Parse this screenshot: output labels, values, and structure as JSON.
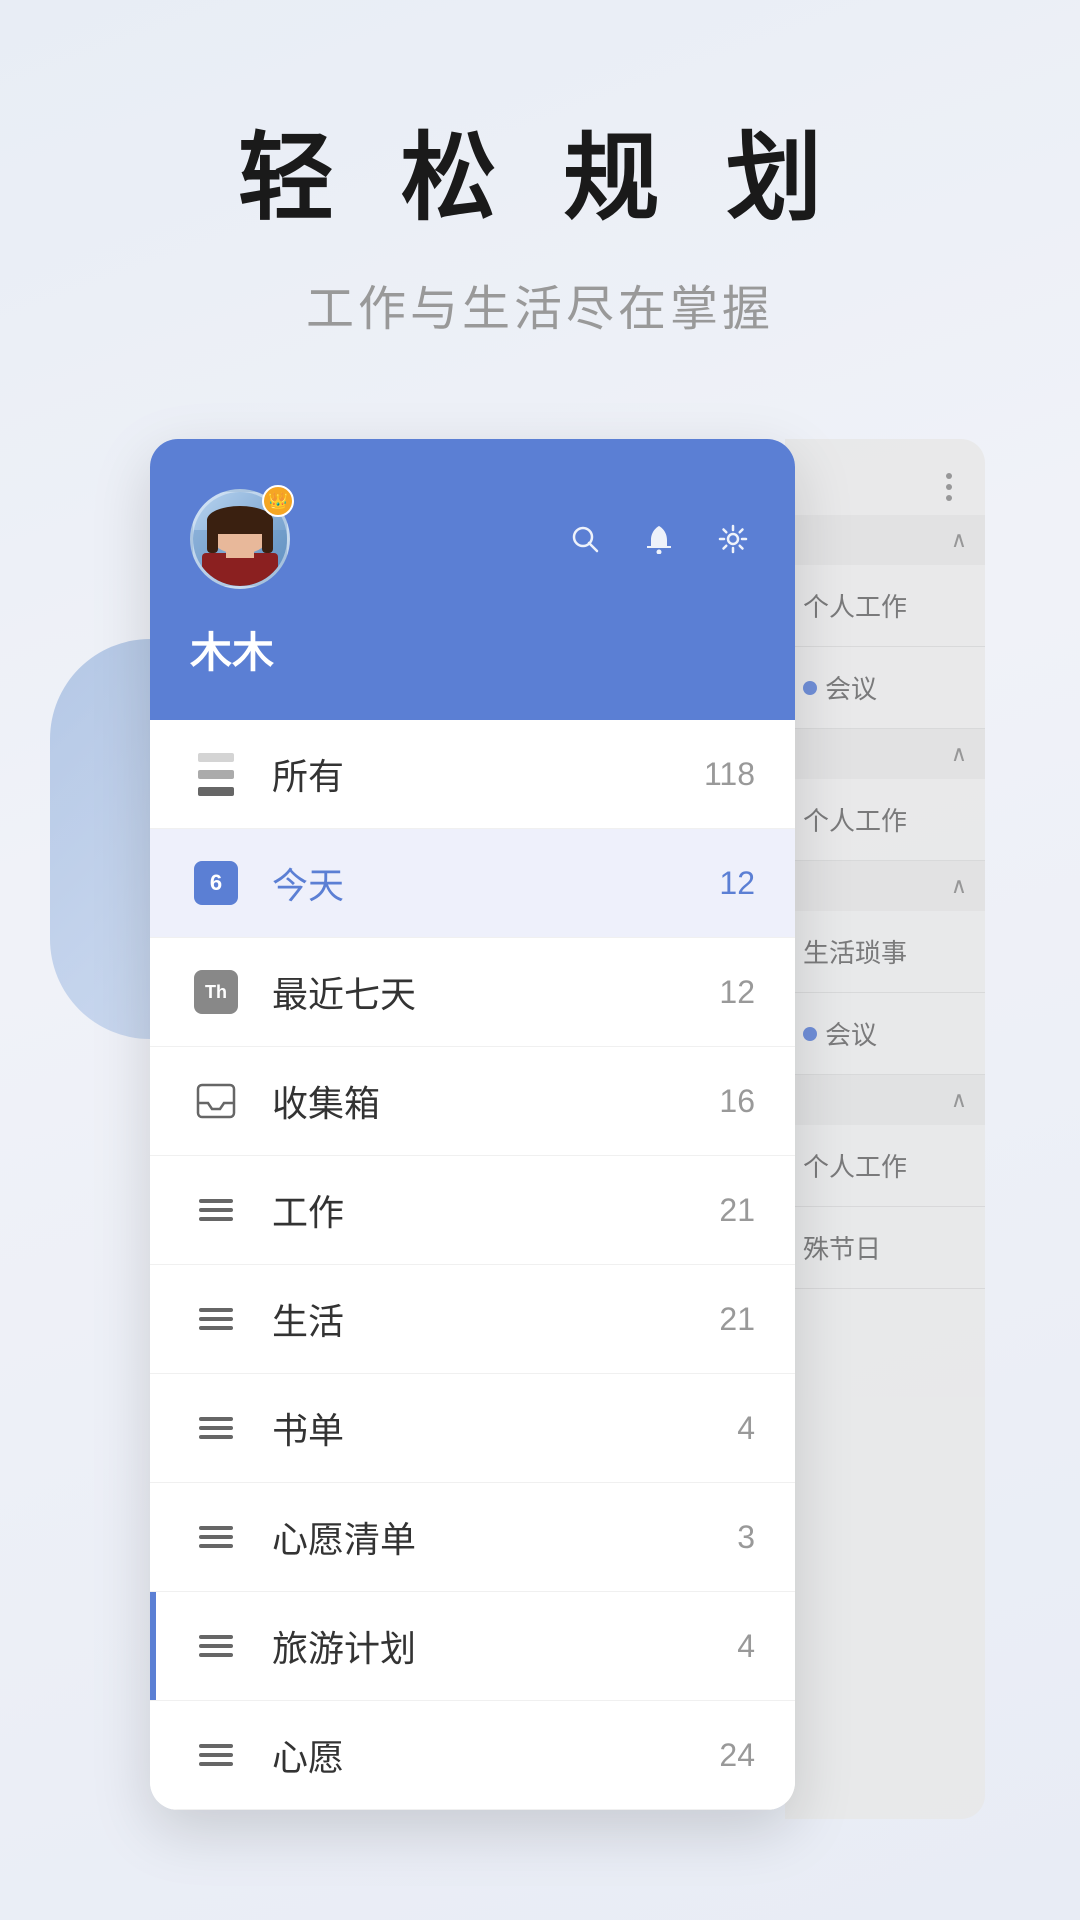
{
  "page": {
    "background": "#f0f2f7"
  },
  "hero": {
    "title": "轻 松 规 划",
    "subtitle": "工作与生活尽在掌握"
  },
  "user": {
    "name": "木木",
    "avatar_alt": "user avatar",
    "crown_icon": "👑"
  },
  "header_icons": {
    "search": "🔍",
    "bell": "🔔",
    "gear": "⚙️"
  },
  "menu_items": [
    {
      "id": "all",
      "icon_type": "stack",
      "label": "所有",
      "count": "118",
      "active": false
    },
    {
      "id": "today",
      "icon_type": "calendar_today",
      "label": "今天",
      "count": "12",
      "active": true,
      "day": "6"
    },
    {
      "id": "week",
      "icon_type": "calendar_th",
      "label": "最近七天",
      "count": "12",
      "active": false
    },
    {
      "id": "inbox",
      "icon_type": "inbox",
      "label": "收集箱",
      "count": "16",
      "active": false
    },
    {
      "id": "work",
      "icon_type": "lines",
      "label": "工作",
      "count": "21",
      "active": false
    },
    {
      "id": "life",
      "icon_type": "lines",
      "label": "生活",
      "count": "21",
      "active": false
    },
    {
      "id": "books",
      "icon_type": "lines",
      "label": "书单",
      "count": "4",
      "active": false
    },
    {
      "id": "wish",
      "icon_type": "lines",
      "label": "心愿清单",
      "count": "3",
      "active": false
    },
    {
      "id": "travel",
      "icon_type": "lines",
      "label": "旅游计划",
      "count": "4",
      "active": false
    },
    {
      "id": "wish2",
      "icon_type": "lines",
      "label": "心愿",
      "count": "24",
      "active": false
    }
  ],
  "right_panel": {
    "items": [
      {
        "type": "header",
        "label": "^"
      },
      {
        "type": "task",
        "label": "个人工作",
        "has_dot": false
      },
      {
        "type": "task",
        "label": "●会议",
        "has_dot": true
      },
      {
        "type": "header",
        "label": "^"
      },
      {
        "type": "task",
        "label": "个人工作",
        "has_dot": false
      },
      {
        "type": "header",
        "label": "^"
      },
      {
        "type": "task",
        "label": "生活琐事",
        "has_dot": false
      },
      {
        "type": "task",
        "label": "●会议",
        "has_dot": true
      },
      {
        "type": "header",
        "label": "^"
      },
      {
        "type": "task",
        "label": "个人工作",
        "has_dot": false
      },
      {
        "type": "task",
        "label": "殊节日",
        "has_dot": false
      }
    ]
  }
}
